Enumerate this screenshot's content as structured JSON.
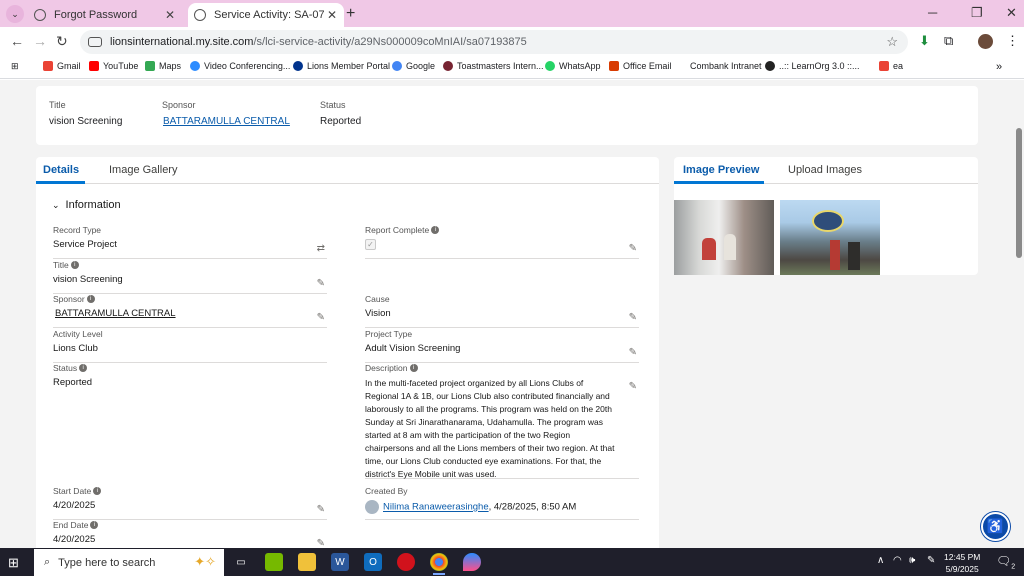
{
  "browser": {
    "tabs": [
      {
        "title": "Forgot Password",
        "active": false
      },
      {
        "title": "Service Activity: SA-07193875",
        "active": true
      }
    ],
    "url_host": "lionsinternational.my.site.com",
    "url_path": "/s/lci-service-activity/a29Ns000009coMnIAI/sa07193875",
    "bookmarks": [
      "Gmail",
      "YouTube",
      "Maps",
      "Video Conferencing...",
      "Lions Member Portal",
      "Google",
      "Toastmasters Intern...",
      "WhatsApp",
      "Office Email",
      "Combank Intranet",
      "..:: LearnOrg 3.0 ::...",
      "ea"
    ]
  },
  "highlights": {
    "title_label": "Title",
    "title_value": "vision Screening",
    "sponsor_label": "Sponsor",
    "sponsor_value": "BATTARAMULLA CENTRAL",
    "status_label": "Status",
    "status_value": "Reported"
  },
  "detail": {
    "tabs": [
      "Details",
      "Image Gallery"
    ],
    "section_title": "Information",
    "left_fields": {
      "record_type": {
        "label": "Record Type",
        "value": "Service Project"
      },
      "title": {
        "label": "Title",
        "value": "vision Screening"
      },
      "sponsor": {
        "label": "Sponsor",
        "value": "BATTARAMULLA CENTRAL"
      },
      "activity_level": {
        "label": "Activity Level",
        "value": "Lions Club"
      },
      "status": {
        "label": "Status",
        "value": "Reported"
      },
      "start_date": {
        "label": "Start Date",
        "value": "4/20/2025"
      },
      "end_date": {
        "label": "End Date",
        "value": "4/20/2025"
      }
    },
    "right_fields": {
      "report_complete": {
        "label": "Report Complete",
        "checked": true
      },
      "cause": {
        "label": "Cause",
        "value": "Vision"
      },
      "project_type": {
        "label": "Project Type",
        "value": "Adult Vision Screening"
      },
      "description": {
        "label": "Description",
        "value": "In the multi-faceted project organized by all Lions Clubs of Regional 1A & 1B, our Lions Club also contributed financially and laborously to all the programs. This program was held on the 20th Sunday at Sri Jinarathanarama, Udahamulla. The program was started at 8 am with the participation of the two Region chairpersons and all the Lions members of their two region. At that time, our Lions Club conducted eye examinations. For that, the district's Eye Mobile unit was used."
      },
      "created_by": {
        "label": "Created By",
        "user": "Nilima Ranaweerasinghe",
        "timestamp": ", 4/28/2025, 8:50 AM"
      }
    }
  },
  "side": {
    "tabs": [
      "Image Preview",
      "Upload Images"
    ]
  },
  "taskbar": {
    "search_placeholder": "Type here to search",
    "time": "12:45 PM",
    "date": "5/9/2025",
    "notification_count": "2"
  },
  "colors": {
    "tab_strip": "#f0c8e6",
    "link": "#0b5cab",
    "accent": "#0176d3",
    "taskbar": "#1f1f2b"
  }
}
